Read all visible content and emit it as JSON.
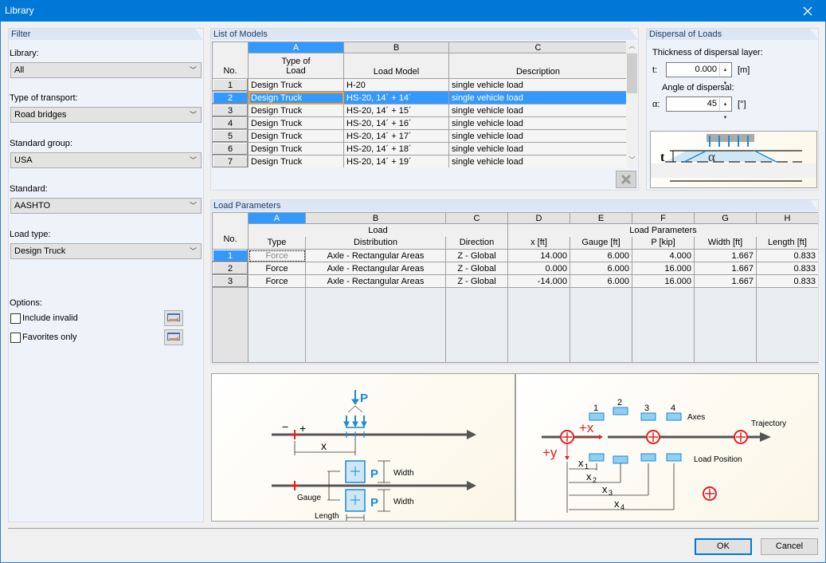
{
  "window": {
    "title": "Library",
    "close_icon": "close-icon"
  },
  "filter": {
    "header": "Filter",
    "library": {
      "label": "Library:",
      "value": "All"
    },
    "transport": {
      "label": "Type of transport:",
      "value": "Road bridges"
    },
    "standard_group": {
      "label": "Standard group:",
      "value": "USA"
    },
    "standard": {
      "label": "Standard:",
      "value": "AASHTO"
    },
    "load_type": {
      "label": "Load type:",
      "value": "Design Truck"
    },
    "options_label": "Options:",
    "include_invalid": {
      "label": "Include invalid",
      "checked": false
    },
    "favorites_only": {
      "label": "Favorites only",
      "checked": false
    }
  },
  "models": {
    "header": "List of Models",
    "col_letters": [
      "A",
      "B",
      "C"
    ],
    "no_label": "No.",
    "col_headers": [
      "Type of\nLoad",
      "Load Model",
      "Description"
    ],
    "col_header_a1": "Type of",
    "col_header_a2": "Load",
    "selected_row": 2,
    "rows": [
      {
        "no": "1",
        "type": "Design Truck",
        "model": "H-20",
        "desc": "single vehicle load"
      },
      {
        "no": "2",
        "type": "Design Truck",
        "model": "HS-20, 14´ + 14´",
        "desc": "single vehicle load"
      },
      {
        "no": "3",
        "type": "Design Truck",
        "model": "HS-20, 14´ + 15´",
        "desc": "single vehicle load"
      },
      {
        "no": "4",
        "type": "Design Truck",
        "model": "HS-20, 14´ + 16´",
        "desc": "single vehicle load"
      },
      {
        "no": "5",
        "type": "Design Truck",
        "model": "HS-20, 14´ + 17´",
        "desc": "single vehicle load"
      },
      {
        "no": "6",
        "type": "Design Truck",
        "model": "HS-20, 14´ + 18´",
        "desc": "single vehicle load"
      },
      {
        "no": "7",
        "type": "Design Truck",
        "model": "HS-20, 14´ + 19´",
        "desc": "single vehicle load"
      }
    ]
  },
  "dispersal": {
    "header": "Dispersal of Loads",
    "thickness_label": "Thickness of dispersal layer:",
    "t_label": "t:",
    "t_value": "0.000",
    "t_unit": "[m]",
    "angle_label": "Angle of dispersal:",
    "alpha_label": "α:",
    "alpha_value": "45",
    "alpha_unit": "[°]",
    "diagram": {
      "t": "t",
      "alpha": "α"
    }
  },
  "params": {
    "header": "Load Parameters",
    "col_letters": [
      "A",
      "B",
      "C",
      "D",
      "E",
      "F",
      "G",
      "H"
    ],
    "no_label": "No.",
    "group_load": "Load",
    "group_params": "Load Parameters",
    "col_headers": [
      "Type",
      "Distribution",
      "Direction",
      "x [ft]",
      "Gauge [ft]",
      "P [kip]",
      "Width [ft]",
      "Length [ft]"
    ],
    "rows": [
      {
        "no": "1",
        "type": "Force",
        "dist": "Axle - Rectangular Areas",
        "dir": "Z - Global",
        "x": "14.000",
        "gauge": "6.000",
        "p": "4.000",
        "width": "1.667",
        "length": "0.833"
      },
      {
        "no": "2",
        "type": "Force",
        "dist": "Axle - Rectangular Areas",
        "dir": "Z - Global",
        "x": "0.000",
        "gauge": "6.000",
        "p": "16.000",
        "width": "1.667",
        "length": "0.833"
      },
      {
        "no": "3",
        "type": "Force",
        "dist": "Axle - Rectangular Areas",
        "dir": "Z - Global",
        "x": "-14.000",
        "gauge": "6.000",
        "p": "16.000",
        "width": "1.667",
        "length": "0.833"
      }
    ]
  },
  "diagram_left": {
    "p": "P",
    "minus": "−",
    "plus": "+",
    "x": "x",
    "width1": "Width",
    "width2": "Width",
    "gauge": "Gauge",
    "length": "Length"
  },
  "diagram_right": {
    "axes": "Axes",
    "trajectory": "Trajectory",
    "load_position": "Load Position",
    "plus_x": "+x",
    "plus_y": "+y",
    "n1": "1",
    "n2": "2",
    "n3": "3",
    "n4": "4",
    "x1": "x",
    "x2": "x",
    "x3": "x",
    "x4": "x",
    "s1": "1",
    "s2": "2",
    "s3": "3",
    "s4": "4"
  },
  "buttons": {
    "ok": "OK",
    "cancel": "Cancel"
  }
}
